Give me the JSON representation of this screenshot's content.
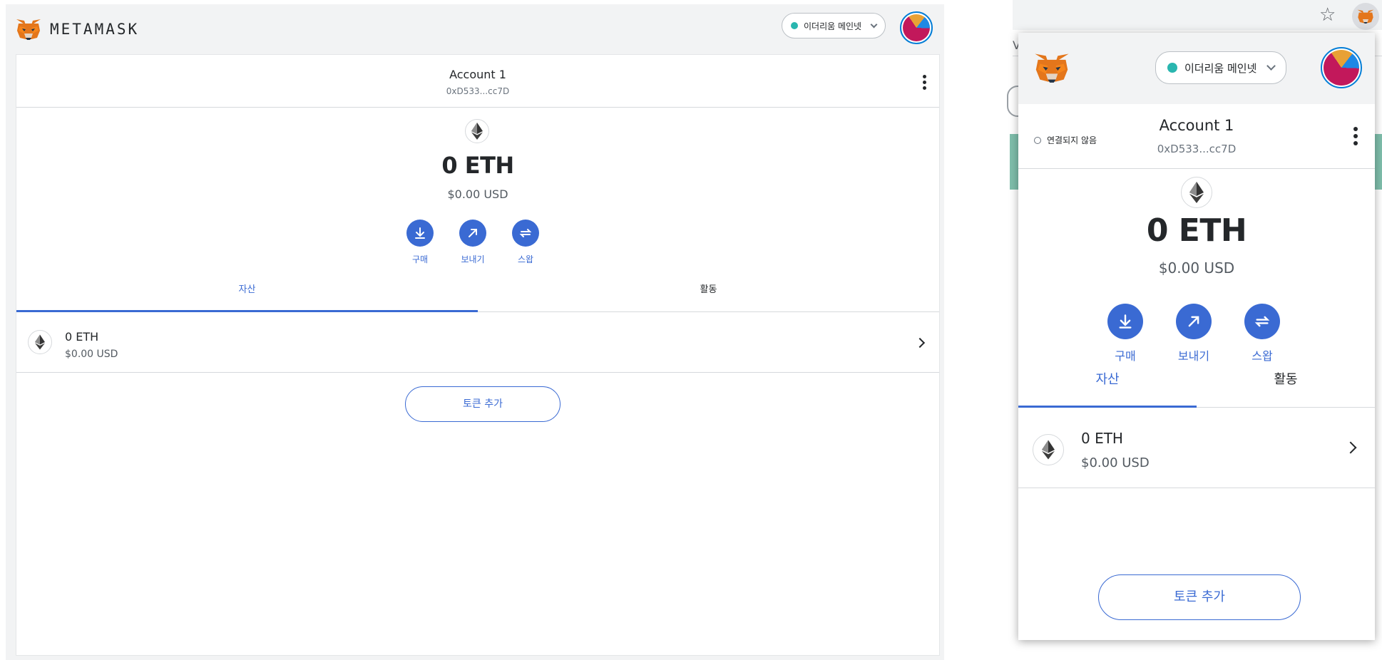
{
  "full_page": {
    "brand": "METAMASK",
    "network_label": "이더리움 메인넷",
    "account_name": "Account 1",
    "account_address": "0xD533...cc7D",
    "balance": "0 ETH",
    "balance_usd": "$0.00 USD",
    "actions": [
      {
        "label": "구매",
        "icon": "download-icon"
      },
      {
        "label": "보내기",
        "icon": "arrow-up-right-icon"
      },
      {
        "label": "스왑",
        "icon": "swap-icon"
      }
    ],
    "tabs": [
      {
        "label": "자산",
        "active": true
      },
      {
        "label": "활동",
        "active": false
      }
    ],
    "asset": {
      "amount": "0 ETH",
      "usd": "$0.00 USD"
    },
    "add_token_label": "토큰 추가"
  },
  "popup": {
    "network_label": "이더리움 메인넷",
    "connection_status": "연결되지 않음",
    "account_name": "Account 1",
    "account_address": "0xD533...cc7D",
    "balance": "0 ETH",
    "balance_usd": "$0.00 USD",
    "actions": [
      {
        "label": "구매",
        "icon": "download-icon"
      },
      {
        "label": "보내기",
        "icon": "arrow-up-right-icon"
      },
      {
        "label": "스왑",
        "icon": "swap-icon"
      }
    ],
    "tabs": [
      {
        "label": "자산",
        "active": true
      },
      {
        "label": "활동",
        "active": false
      }
    ],
    "asset": {
      "amount": "0 ETH",
      "usd": "$0.00 USD"
    },
    "add_token_label": "토큰 추가"
  },
  "browser": {
    "page_fragment_text": "V",
    "bookmark_icon": "star-icon",
    "extension_icon": "metamask-fox-icon"
  },
  "colors": {
    "accent": "#3a6ad3",
    "network_dot": "#29b6af",
    "header_bg": "#f2f3f4",
    "text": "#24272a",
    "muted": "#6a737d"
  }
}
